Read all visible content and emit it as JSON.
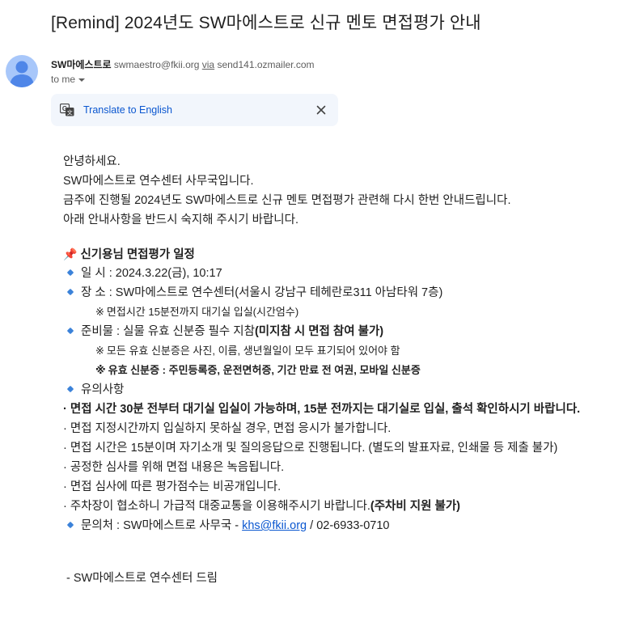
{
  "subject": "[Remind] 2024년도 SW마에스트로 신규 멘토 면접평가 안내",
  "sender": {
    "name": "SW마에스트로",
    "email": "swmaestro@fkii.org",
    "via_label": "via",
    "relay": "send141.ozmailer.com",
    "to_label": "to me"
  },
  "translate": {
    "link": "Translate to English"
  },
  "body": {
    "greeting": "안녕하세요.",
    "intro1": "SW마에스트로 연수센터 사무국입니다.",
    "intro2": "금주에 진행될 2024년도 SW마에스트로 신규 멘토 면접평가 관련해 다시 한번 안내드립니다.",
    "intro3": "아래 안내사항을 반드시 숙지해 주시기 바랍니다.",
    "section_title": "신기용님 면접평가 일정",
    "date_line": "일 시 : 2024.3.22(금), 10:17",
    "place_line": "장 소 : SW마에스트로 연수센터(서울시 강남구 테헤란로311 아남타워 7층)",
    "place_note": "면접시간 15분전까지 대기실 입실(시간엄수)",
    "prep_line_pre": "준비물 : 실물 유효 신분증 필수 지참",
    "prep_line_bold": "(미지참 시 면접 참여 불가)",
    "prep_note1": "모든 유효 신분증은 사진, 이름, 생년월일이 모두 표기되어 있어야 함",
    "prep_note2": "유효 신분증 : 주민등록증, 운전면허증, 기간 만료 전 여권, 모바일 신분증",
    "notes_title": "유의사항",
    "note1": "면접 시간 30분 전부터 대기실 입실이 가능하며, 15분 전까지는 대기실로 입실, 출석 확인하시기 바랍니다.",
    "note2": "면접 지정시간까지 입실하지 못하실 경우, 면접 응시가 불가합니다.",
    "note3": "면접 시간은 15분이며 자기소개 및 질의응답으로 진행됩니다. (별도의 발표자료, 인쇄물 등 제출 불가)",
    "note4": "공정한 심사를 위해 면접 내용은 녹음됩니다.",
    "note5": "면접 심사에 따른 평가점수는 비공개입니다.",
    "note6_pre": "주차장이 협소하니 가급적 대중교통을 이용해주시기 바랍니다.",
    "note6_bold": "(주차비 지원 불가)",
    "contact_pre": "문의처 : SW마에스트로 사무국 - ",
    "contact_email": "khs@fkii.org",
    "contact_post": " / 02-6933-0710",
    "signature": "- SW마에스트로 연수센터 드림"
  },
  "icons": {
    "translate": "translate-icon",
    "close": "close-icon",
    "pin": "pushpin-icon",
    "bullet": "small-blue-diamond-icon",
    "reference_mark": "※",
    "middle_dot": "·"
  },
  "colors": {
    "link": "#0b57d0",
    "diamond": "#3b82d9",
    "translate_bg": "#f2f6fc",
    "avatar_bg": "#a8c7fa"
  }
}
